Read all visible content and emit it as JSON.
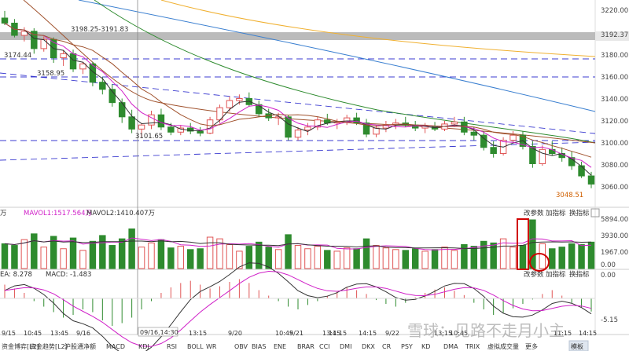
{
  "colors": {
    "up": "#e05555",
    "down": "#2e8b2e",
    "ma_magenta": "#d020c8",
    "ma_black": "#333333",
    "ma_brown": "#a0522d",
    "ma_green": "#2e8b2e",
    "ma_blue": "#3a7fd0",
    "ma_orange": "#f0b030",
    "hline": "#3b3bd0",
    "price_band": "#bbbbbb",
    "accent_red": "#d00000"
  },
  "price_axis": {
    "ticks": [
      "3220.00",
      "3200.00",
      "3180.00",
      "3160.00",
      "3140.00",
      "3120.00",
      "3100.00",
      "3080.00",
      "3060.00"
    ],
    "current": "3192.37"
  },
  "annotations": {
    "range": "3198.25-3191.83",
    "level1": "3174.44",
    "level2": "3158.95",
    "level3": "3101.65",
    "last_low": "3048.51"
  },
  "volume_panel": {
    "unit_prefix": "万",
    "mavol1": "MAVOL1:1517.564万",
    "mavol2": "MAVOL2:1410.407万",
    "ticks": [
      "5894.00",
      "3930.00",
      "1967.00",
      "0.00"
    ],
    "buttons": [
      "改参数",
      "加指标",
      "换指标"
    ]
  },
  "macd_panel": {
    "ema": "EA: 8.278",
    "macd": "MACD: -1.483",
    "ticks": [
      "0.00",
      "-5.15"
    ],
    "buttons": [
      "改参数",
      "加指标",
      "换指标"
    ]
  },
  "time_axis": {
    "labels": [
      "9/15",
      "10:45",
      "13:45",
      "9/16",
      "13:15",
      "9/20",
      "10:45",
      "13:45",
      "9/21",
      "11:15",
      "14:15",
      "9/22",
      "13:15",
      "10:45",
      "11:15",
      "14:15"
    ],
    "crosshair_label": "09/16,14:30"
  },
  "bottom_tabs": {
    "items": [
      "资金博弈[L2]",
      "资金趋势[L2]",
      "沪股通净额",
      "MACD",
      "KDJ",
      "RSI",
      "BOLL",
      "WR",
      "OBV",
      "BIAS",
      "ENE",
      "BRAR",
      "CCI",
      "DMI",
      "DKX",
      "CR",
      "PSY",
      "KD",
      "DMA",
      "TRIX",
      "虚拟成交量",
      "更多",
      "模板"
    ],
    "active": "MACD"
  },
  "watermark": "雪球：见路不走月小主",
  "chart_data": {
    "type": "candlestick",
    "note_series": "OHLC per bar, 60-min K line",
    "ohlc": [
      [
        3215,
        3222,
        3208,
        3210
      ],
      [
        3210,
        3214,
        3196,
        3198
      ],
      [
        3198,
        3206,
        3192,
        3202
      ],
      [
        3202,
        3205,
        3180,
        3185
      ],
      [
        3185,
        3197,
        3182,
        3194
      ],
      [
        3194,
        3196,
        3171,
        3176
      ],
      [
        3176,
        3183,
        3168,
        3180
      ],
      [
        3180,
        3184,
        3162,
        3165
      ],
      [
        3165,
        3172,
        3160,
        3170
      ],
      [
        3170,
        3172,
        3148,
        3152
      ],
      [
        3152,
        3157,
        3140,
        3145
      ],
      [
        3145,
        3150,
        3128,
        3132
      ],
      [
        3132,
        3136,
        3112,
        3118
      ],
      [
        3118,
        3125,
        3102,
        3106
      ],
      [
        3106,
        3112,
        3098,
        3110
      ],
      [
        3110,
        3124,
        3106,
        3120
      ],
      [
        3120,
        3126,
        3105,
        3108
      ],
      [
        3108,
        3112,
        3100,
        3103
      ],
      [
        3103,
        3110,
        3100,
        3107
      ],
      [
        3107,
        3112,
        3101,
        3104
      ],
      [
        3104,
        3108,
        3099,
        3102
      ],
      [
        3102,
        3118,
        3101,
        3115
      ],
      [
        3115,
        3130,
        3112,
        3127
      ],
      [
        3127,
        3138,
        3123,
        3134
      ],
      [
        3134,
        3140,
        3130,
        3136
      ],
      [
        3136,
        3142,
        3128,
        3130
      ],
      [
        3130,
        3134,
        3118,
        3121
      ],
      [
        3121,
        3126,
        3114,
        3117
      ],
      [
        3117,
        3122,
        3110,
        3118
      ],
      [
        3118,
        3120,
        3095,
        3098
      ],
      [
        3098,
        3108,
        3095,
        3105
      ],
      [
        3105,
        3112,
        3100,
        3108
      ],
      [
        3108,
        3118,
        3105,
        3115
      ],
      [
        3115,
        3121,
        3110,
        3112
      ],
      [
        3112,
        3116,
        3106,
        3113
      ],
      [
        3113,
        3120,
        3110,
        3117
      ],
      [
        3117,
        3122,
        3110,
        3112
      ],
      [
        3112,
        3116,
        3098,
        3101
      ],
      [
        3101,
        3110,
        3098,
        3107
      ],
      [
        3107,
        3114,
        3103,
        3110
      ],
      [
        3110,
        3116,
        3106,
        3112
      ],
      [
        3112,
        3118,
        3108,
        3110
      ],
      [
        3110,
        3114,
        3104,
        3107
      ],
      [
        3107,
        3112,
        3102,
        3109
      ],
      [
        3109,
        3113,
        3104,
        3106
      ],
      [
        3106,
        3114,
        3104,
        3111
      ],
      [
        3111,
        3118,
        3108,
        3113
      ],
      [
        3113,
        3118,
        3100,
        3103
      ],
      [
        3103,
        3108,
        3095,
        3100
      ],
      [
        3100,
        3104,
        3085,
        3088
      ],
      [
        3088,
        3094,
        3078,
        3082
      ],
      [
        3082,
        3098,
        3080,
        3095
      ],
      [
        3095,
        3104,
        3092,
        3100
      ],
      [
        3100,
        3104,
        3086,
        3089
      ],
      [
        3089,
        3094,
        3068,
        3072
      ],
      [
        3072,
        3090,
        3070,
        3086
      ],
      [
        3086,
        3094,
        3080,
        3082
      ],
      [
        3082,
        3088,
        3074,
        3078
      ],
      [
        3078,
        3084,
        3066,
        3070
      ],
      [
        3070,
        3074,
        3058,
        3060
      ],
      [
        3060,
        3064,
        3048,
        3052
      ]
    ],
    "volume": [
      3000,
      2800,
      3500,
      4200,
      2600,
      3900,
      2400,
      3700,
      2200,
      3300,
      4000,
      2800,
      3600,
      4800,
      2600,
      3100,
      3500,
      2500,
      2700,
      2300,
      2400,
      3800,
      3600,
      2900,
      2100,
      2700,
      3200,
      2600,
      2300,
      4100,
      2800,
      2400,
      2700,
      2200,
      2100,
      2500,
      2400,
      3600,
      2800,
      2500,
      2300,
      2200,
      2400,
      2100,
      2300,
      2600,
      2200,
      2900,
      2700,
      3300,
      3100,
      3600,
      2600,
      2800,
      5894,
      3000,
      2400,
      2600,
      3000,
      2900,
      3200
    ],
    "macd_hist": [
      2.5,
      1.8,
      1.0,
      -0.5,
      -1.5,
      -2.5,
      -3.5,
      -3.0,
      -2.0,
      -2.5,
      -4.0,
      -5.0,
      -4.5,
      -3.5,
      -2.0,
      -0.5,
      1.0,
      2.0,
      2.8,
      3.2,
      2.5,
      1.8,
      2.2,
      3.0,
      3.5,
      2.8,
      1.5,
      0.5,
      -0.5,
      -1.5,
      -2.0,
      -1.2,
      -0.5,
      0.5,
      1.2,
      2.0,
      1.5,
      0.8,
      -0.3,
      -1.0,
      -1.5,
      -0.8,
      0.2,
      1.0,
      1.6,
      2.0,
      1.4,
      0.6,
      -0.8,
      -2.0,
      -3.0,
      -2.6,
      -1.8,
      -1.0,
      -0.2,
      0.8,
      1.5,
      0.5,
      -0.8,
      -1.6,
      -2.4
    ],
    "ylim": [
      3040,
      3225
    ],
    "volume_max": 5894
  }
}
